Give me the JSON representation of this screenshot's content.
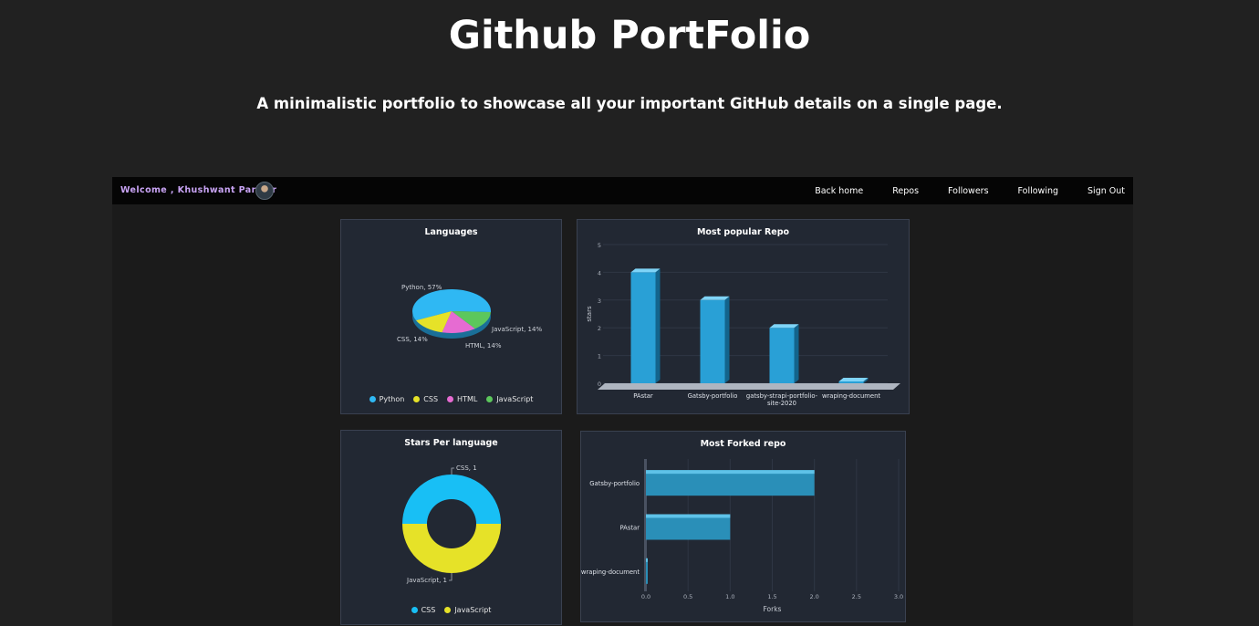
{
  "page": {
    "title": "Github PortFolio",
    "subtitle": "A minimalistic portfolio to showcase all your important GitHub details on a single page."
  },
  "nav": {
    "welcome": "Welcome , Khushwant Parihar",
    "avatar_icon": "user-avatar-icon",
    "links": [
      "Back home",
      "Repos",
      "Followers",
      "Following",
      "Sign Out"
    ]
  },
  "colors": {
    "python": "#2fb8f3",
    "css": "#e6e228",
    "html": "#e66bd2",
    "javascript": "#5cc75c",
    "bar_blue": "#29a0d6",
    "welcome_text": "#c9a4f5"
  },
  "chart_data": [
    {
      "type": "pie",
      "title": "Languages",
      "slices": [
        {
          "name": "Python",
          "value": 57,
          "label": "Python, 57%"
        },
        {
          "name": "CSS",
          "value": 14,
          "label": "CSS, 14%"
        },
        {
          "name": "HTML",
          "value": 14,
          "label": "HTML, 14%"
        },
        {
          "name": "JavaScript",
          "value": 14,
          "label": "JavaScript, 14%"
        }
      ],
      "legend": [
        "Python",
        "CSS",
        "HTML",
        "JavaScript"
      ]
    },
    {
      "type": "bar",
      "title": "Most popular Repo",
      "ylabel": "stars",
      "categories": [
        "PAstar",
        "Gatsby-portfolio",
        "gatsby-strapi-portfolio-site-2020",
        "wraping-document"
      ],
      "category_lines": [
        [
          "PAstar"
        ],
        [
          "Gatsby-portfolio"
        ],
        [
          "gatsby-strapi-portfolio-",
          "site-2020"
        ],
        [
          "wraping-document"
        ]
      ],
      "values": [
        4,
        3,
        2,
        0
      ],
      "ylim": [
        0,
        5
      ],
      "yticks": [
        "0",
        "1",
        "2",
        "3",
        "4",
        "5"
      ]
    },
    {
      "type": "pie",
      "title": "Stars Per language",
      "slices": [
        {
          "name": "CSS",
          "value": 1,
          "label": "CSS, 1"
        },
        {
          "name": "JavaScript",
          "value": 1,
          "label": "JavaScript, 1"
        }
      ],
      "legend": [
        "CSS",
        "JavaScript"
      ]
    },
    {
      "type": "bar",
      "orientation": "horizontal",
      "title": "Most Forked repo",
      "xlabel": "Forks",
      "categories": [
        "Gatsby-portfolio",
        "PAstar",
        "wraping-document"
      ],
      "values": [
        2,
        1,
        0
      ],
      "xlim": [
        0,
        3
      ],
      "xticks": [
        "0.0",
        "0.5",
        "1.0",
        "1.5",
        "2.0",
        "2.5",
        "3.0"
      ]
    }
  ]
}
